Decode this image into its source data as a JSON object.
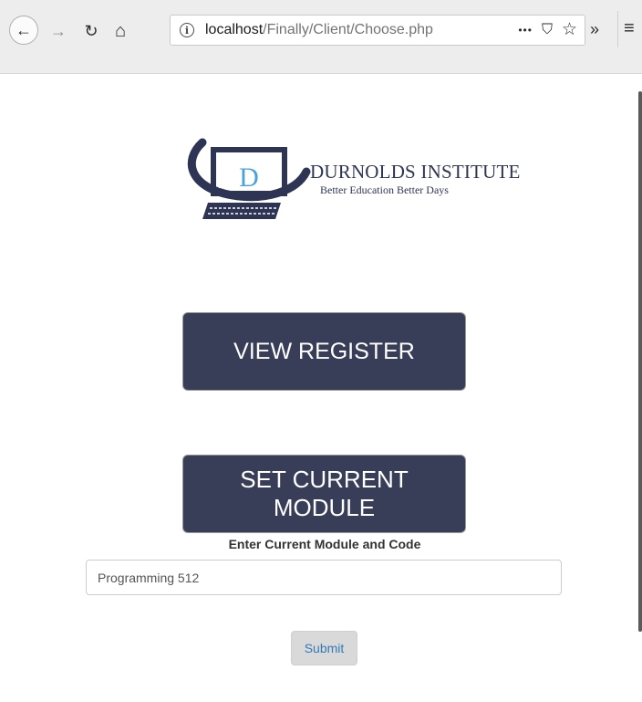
{
  "browser": {
    "url_host": "localhost",
    "url_path": "/Finally/Client/Choose.php",
    "icons": {
      "back": "←",
      "forward": "→",
      "reload": "↻",
      "home": "⌂",
      "info": "i",
      "page_actions": "•••",
      "pocket": "⛉",
      "bookmark": "☆",
      "overflow": "»",
      "menu": "≡"
    }
  },
  "logo": {
    "letter": "D",
    "title": "DURNOLDS INSTITUTE",
    "tagline": "Better Education Better Days",
    "colors": {
      "navy": "#2e3554",
      "accent": "#4aa3d8"
    }
  },
  "buttons": {
    "view_register": "VIEW REGISTER",
    "set_current_module": "SET CURRENT MODULE",
    "submit": "Submit"
  },
  "form": {
    "label": "Enter Current Module and Code",
    "module_value": "Programming 512"
  },
  "colors": {
    "button_bg": "#393e58",
    "submit_text": "#337ab7"
  }
}
